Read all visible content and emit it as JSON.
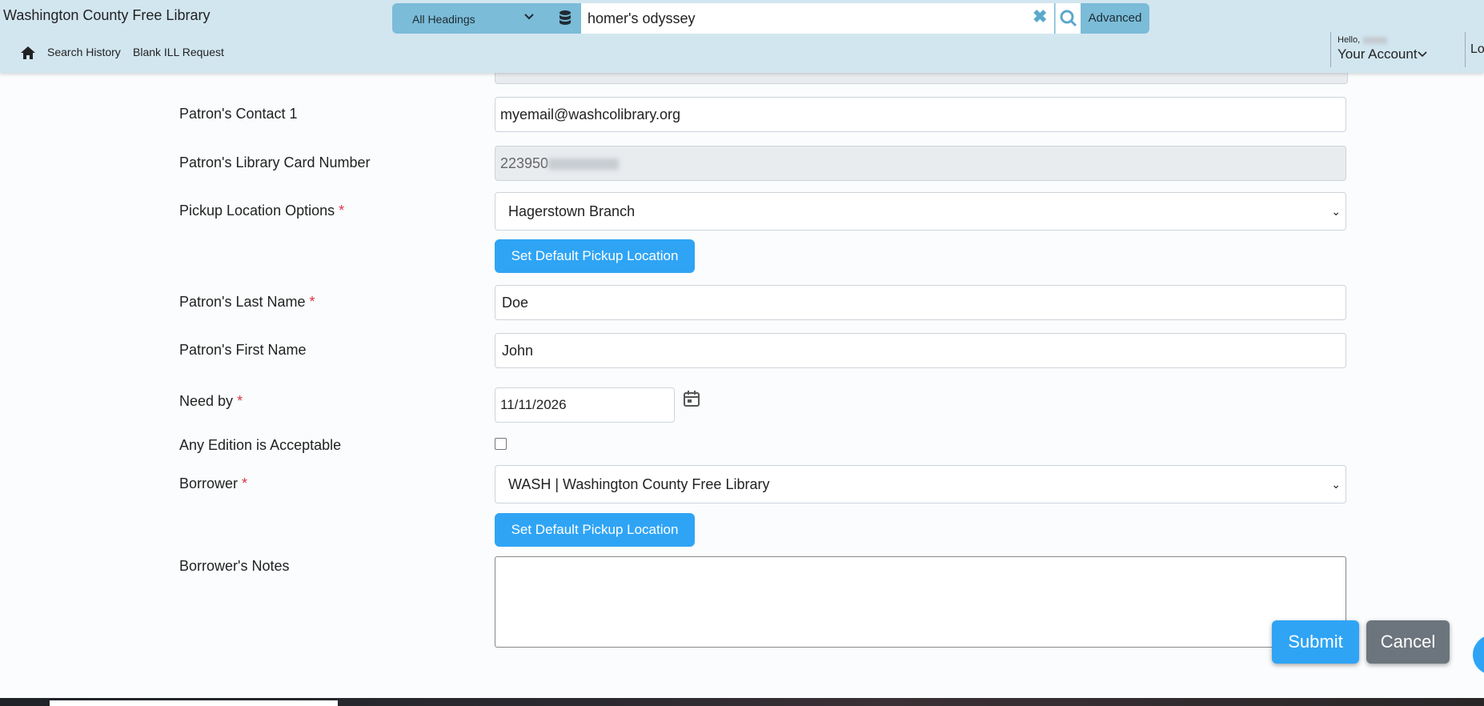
{
  "header": {
    "library_title": "Washington County Free Library",
    "search_scope": "All Headings",
    "search_query": "homer's odyssey",
    "advanced_label": "Advanced",
    "nav": [
      "Search History",
      "Blank ILL Request"
    ],
    "account": {
      "hello": "Hello,",
      "your_account": "Your Account"
    },
    "partial_right_label": "Lo"
  },
  "form": {
    "contact1": {
      "label": "Patron's Contact 1",
      "value": "myemail@washcolibrary.org"
    },
    "card_number": {
      "label": "Patron's Library Card Number",
      "value_visible": "223950"
    },
    "pickup": {
      "label": "Pickup Location Options",
      "required": "*",
      "value": "Hagerstown Branch",
      "button": "Set Default Pickup Location"
    },
    "last_name": {
      "label": "Patron's Last Name",
      "required": "*",
      "value": "Doe"
    },
    "first_name": {
      "label": "Patron's First Name",
      "value": "John"
    },
    "need_by": {
      "label": "Need by",
      "required": "*",
      "value": "11/11/2026"
    },
    "any_edition": {
      "label": "Any Edition is Acceptable",
      "checked": false
    },
    "borrower": {
      "label": "Borrower",
      "required": "*",
      "value": "WASH | Washington County Free Library",
      "button": "Set Default Pickup Location"
    },
    "notes": {
      "label": "Borrower's Notes",
      "value": ""
    }
  },
  "actions": {
    "submit": "Submit",
    "cancel": "Cancel"
  },
  "icons": [
    "home-icon",
    "database-icon",
    "clear-icon",
    "search-icon",
    "chevron-down-icon",
    "calendar-icon"
  ],
  "colors": {
    "header_bg": "#d2e6f0",
    "search_accent": "#7bbcd8",
    "primary": "#2fa4f5",
    "secondary": "#6c757d",
    "required": "#dc3545"
  }
}
